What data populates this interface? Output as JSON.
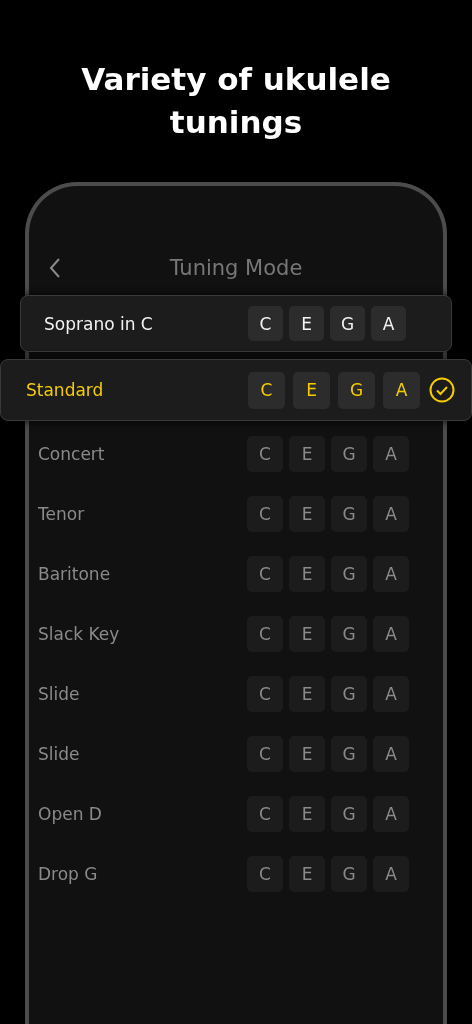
{
  "headline": "Variety of ukulele tunings",
  "screen": {
    "title": "Tuning Mode"
  },
  "tunings": [
    {
      "kind": "category",
      "name": "Soprano in C",
      "notes": [
        "C",
        "E",
        "G",
        "A"
      ],
      "selected": false
    },
    {
      "kind": "option",
      "name": "Standard",
      "notes": [
        "C",
        "E",
        "G",
        "A"
      ],
      "selected": true
    },
    {
      "kind": "option",
      "name": "Concert",
      "notes": [
        "C",
        "E",
        "G",
        "A"
      ],
      "selected": false
    },
    {
      "kind": "option",
      "name": "Tenor",
      "notes": [
        "C",
        "E",
        "G",
        "A"
      ],
      "selected": false
    },
    {
      "kind": "option",
      "name": "Baritone",
      "notes": [
        "C",
        "E",
        "G",
        "A"
      ],
      "selected": false
    },
    {
      "kind": "option",
      "name": "Slack Key",
      "notes": [
        "C",
        "E",
        "G",
        "A"
      ],
      "selected": false
    },
    {
      "kind": "option",
      "name": "Slide",
      "notes": [
        "C",
        "E",
        "G",
        "A"
      ],
      "selected": false
    },
    {
      "kind": "option",
      "name": "Slide",
      "notes": [
        "C",
        "E",
        "G",
        "A"
      ],
      "selected": false
    },
    {
      "kind": "option",
      "name": "Open D",
      "notes": [
        "C",
        "E",
        "G",
        "A"
      ],
      "selected": false
    },
    {
      "kind": "option",
      "name": "Drop G",
      "notes": [
        "C",
        "E",
        "G",
        "A"
      ],
      "selected": false
    }
  ]
}
